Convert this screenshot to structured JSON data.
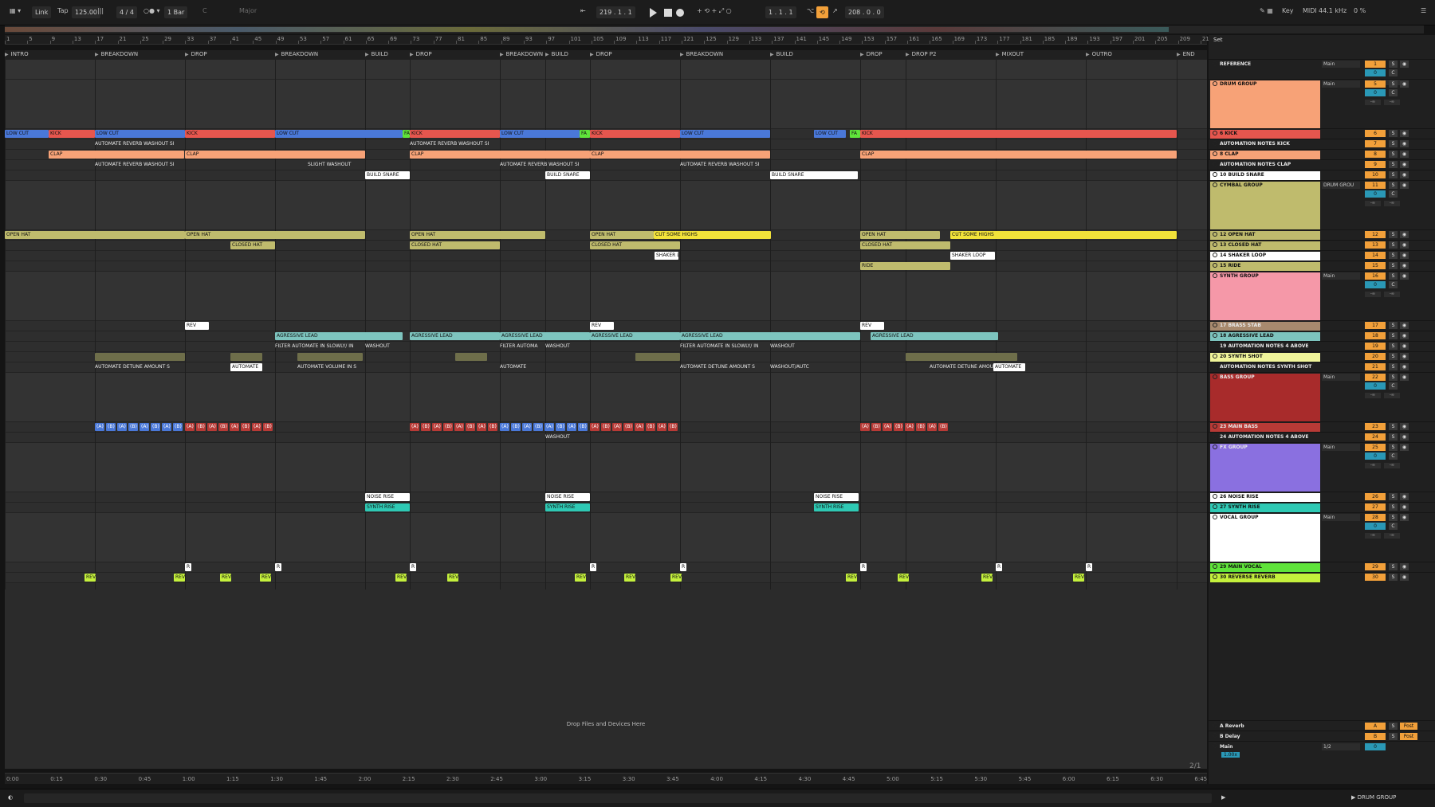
{
  "toolbar": {
    "link": "Link",
    "tap": "Tap",
    "tempo": "125.00",
    "meter": "4 / 4",
    "quantize": "1 Bar",
    "key": "C",
    "scale": "Major",
    "arr_pos": "219 .  1 .  1",
    "loop_start": "1 .  1 .  1",
    "loop_len": "208 .  0 .  0",
    "key_label": "Key",
    "midi_label": "MIDI",
    "sample_rate": "44.1 kHz",
    "cpu": "0 %"
  },
  "ruler": [
    "1",
    "5",
    "9",
    "13",
    "17",
    "21",
    "25",
    "29",
    "33",
    "37",
    "41",
    "45",
    "49",
    "53",
    "57",
    "61",
    "65",
    "69",
    "73",
    "77",
    "81",
    "85",
    "89",
    "93",
    "97",
    "101",
    "105",
    "109",
    "113",
    "117",
    "121",
    "125",
    "129",
    "133",
    "137",
    "141",
    "145",
    "149",
    "153",
    "157",
    "161",
    "165",
    "169",
    "173",
    "177",
    "181",
    "185",
    "189",
    "193",
    "197",
    "201",
    "205",
    "209",
    "213"
  ],
  "locators": [
    "INTRO",
    "BREAKDOWN",
    "DROP",
    "BREAKDOWN",
    "BUILD",
    "DROP",
    "BREAKDOWN",
    "BUILD",
    "DROP",
    "BREAKDOWN",
    "BUILD",
    "DROP",
    "DROP P2",
    "MIXOUT",
    "OUTRO",
    "END"
  ],
  "timeline": [
    "0:00",
    "0:15",
    "0:30",
    "0:45",
    "1:00",
    "1:15",
    "1:30",
    "1:45",
    "2:00",
    "2:15",
    "2:30",
    "2:45",
    "3:00",
    "3:15",
    "3:30",
    "3:45",
    "4:00",
    "4:15",
    "4:30",
    "4:45",
    "5:00",
    "5:15",
    "5:30",
    "5:45",
    "6:00",
    "6:15",
    "6:30",
    "6:45"
  ],
  "arrangement": {
    "drop_message": "Drop Files and Devices Here",
    "pager": "2/1",
    "lanes": [
      {
        "label_a": "LOW CUT",
        "label_b": "KICK",
        "label_c": "FA"
      },
      {
        "label": "AUTOMATE REVERB WASHOUT SI"
      },
      {
        "label": "CLAP"
      },
      {
        "label": "AUTOMATE REVERB WASHOUT SI",
        "label_b": "SLIGHT WASHOUT"
      },
      {
        "label": "BUILD SNARE"
      },
      {
        "label": "OPEN HAT",
        "label_b": "CUT SOME HIGHS"
      },
      {
        "label": "CLOSED HAT"
      },
      {
        "label": "SHAKER",
        "label_b": "SHAKER LOOP"
      },
      {
        "label": "RIDE"
      },
      {
        "label": "BRASS STAB",
        "label_b": "REV"
      },
      {
        "label": "AGRESSIVE LEAD",
        "label_b": "AGRESS"
      },
      {
        "label": "FILTER AUTOMATE IN SLOWLY/ IN",
        "label_b": "WASHOUT",
        "label_c": "FILTER AUTOMA"
      },
      {
        "label": "AUTOMATE DETUNE AMOUNT S",
        "label_b": "AUTOMATE",
        "label_c": "AUTOMATE VOLUME IN S",
        "label_d": "WASHOUT/AUTC"
      },
      {
        "label_a": "(A)",
        "label_b": "(B)"
      },
      {
        "label": "WASHOUT"
      },
      {
        "label": "NOISE RISE"
      },
      {
        "label": "SYNTH RISE"
      },
      {
        "label": "R"
      },
      {
        "label": "REV"
      }
    ]
  },
  "mixer": {
    "set_label": "Set",
    "tracks": [
      {
        "name": "REFERENCE",
        "num": "1",
        "route": "Main",
        "color": "#202020"
      },
      {
        "name": "DRUM GROUP",
        "num": "5",
        "route": "Main",
        "color": "#f7a277"
      },
      {
        "name": "6 KICK",
        "num": "6",
        "color": "#e6564e"
      },
      {
        "name": "AUTOMATION NOTES KICK",
        "num": "7",
        "color": "#202020"
      },
      {
        "name": "8 CLAP",
        "num": "8",
        "color": "#f7a277"
      },
      {
        "name": "AUTOMATION NOTES CLAP",
        "num": "9",
        "color": "#202020"
      },
      {
        "name": "10 BUILD SNARE",
        "num": "10",
        "color": "#ffffff"
      },
      {
        "name": "CYMBAL GROUP",
        "num": "11",
        "route": "DRUM GROU",
        "color": "#bfbb6d"
      },
      {
        "name": "12 OPEN HAT",
        "num": "12",
        "color": "#bfbb6d"
      },
      {
        "name": "13 CLOSED HAT",
        "num": "13",
        "color": "#bfbb6d"
      },
      {
        "name": "14 SHAKER LOOP",
        "num": "14",
        "color": "#ffffff"
      },
      {
        "name": "15 RIDE",
        "num": "15",
        "color": "#bfbb6d"
      },
      {
        "name": "SYNTH GROUP",
        "num": "16",
        "route": "Main",
        "color": "#f598a8"
      },
      {
        "name": "17 BRASS STAB",
        "num": "17",
        "color": "#a88a6e"
      },
      {
        "name": "18 AGRESSIVE LEAD",
        "num": "18",
        "color": "#7dc4be"
      },
      {
        "name": "19 AUTOMATION NOTES 4 ABOVE",
        "num": "19",
        "color": "#202020"
      },
      {
        "name": "20 SYNTH SHOT",
        "num": "20",
        "color": "#f0f59a"
      },
      {
        "name": "AUTOMATION NOTES SYNTH SHOT",
        "num": "21",
        "color": "#202020"
      },
      {
        "name": "BASS GROUP",
        "num": "22",
        "route": "Main",
        "color": "#a82b2b"
      },
      {
        "name": "23 MAIN BASS",
        "num": "23",
        "color": "#b83a36"
      },
      {
        "name": "24 AUTOMATION NOTES 4 ABOVE",
        "num": "24",
        "color": "#202020"
      },
      {
        "name": "FX GROUP",
        "num": "25",
        "route": "Main",
        "color": "#8a70e0"
      },
      {
        "name": "26 NOISE RISE",
        "num": "26",
        "color": "#ffffff"
      },
      {
        "name": "27 SYNTH RISE",
        "num": "27",
        "color": "#2ec9b4"
      },
      {
        "name": "VOCAL GROUP",
        "num": "28",
        "route": "Main",
        "color": "#ffffff"
      },
      {
        "name": "29 MAIN VOCAL",
        "num": "29",
        "color": "#5fe33a"
      },
      {
        "name": "30 REVERSE REVERB",
        "num": "30",
        "color": "#c4f03c"
      }
    ],
    "returns": [
      {
        "name": "A Reverb",
        "num": "A",
        "post": "Post"
      },
      {
        "name": "B Delay",
        "num": "B",
        "post": "Post"
      },
      {
        "name": "Main",
        "route": "1/2",
        "num": "0"
      }
    ],
    "zoom": "1.00x"
  },
  "status": {
    "selected": "DRUM GROUP"
  }
}
